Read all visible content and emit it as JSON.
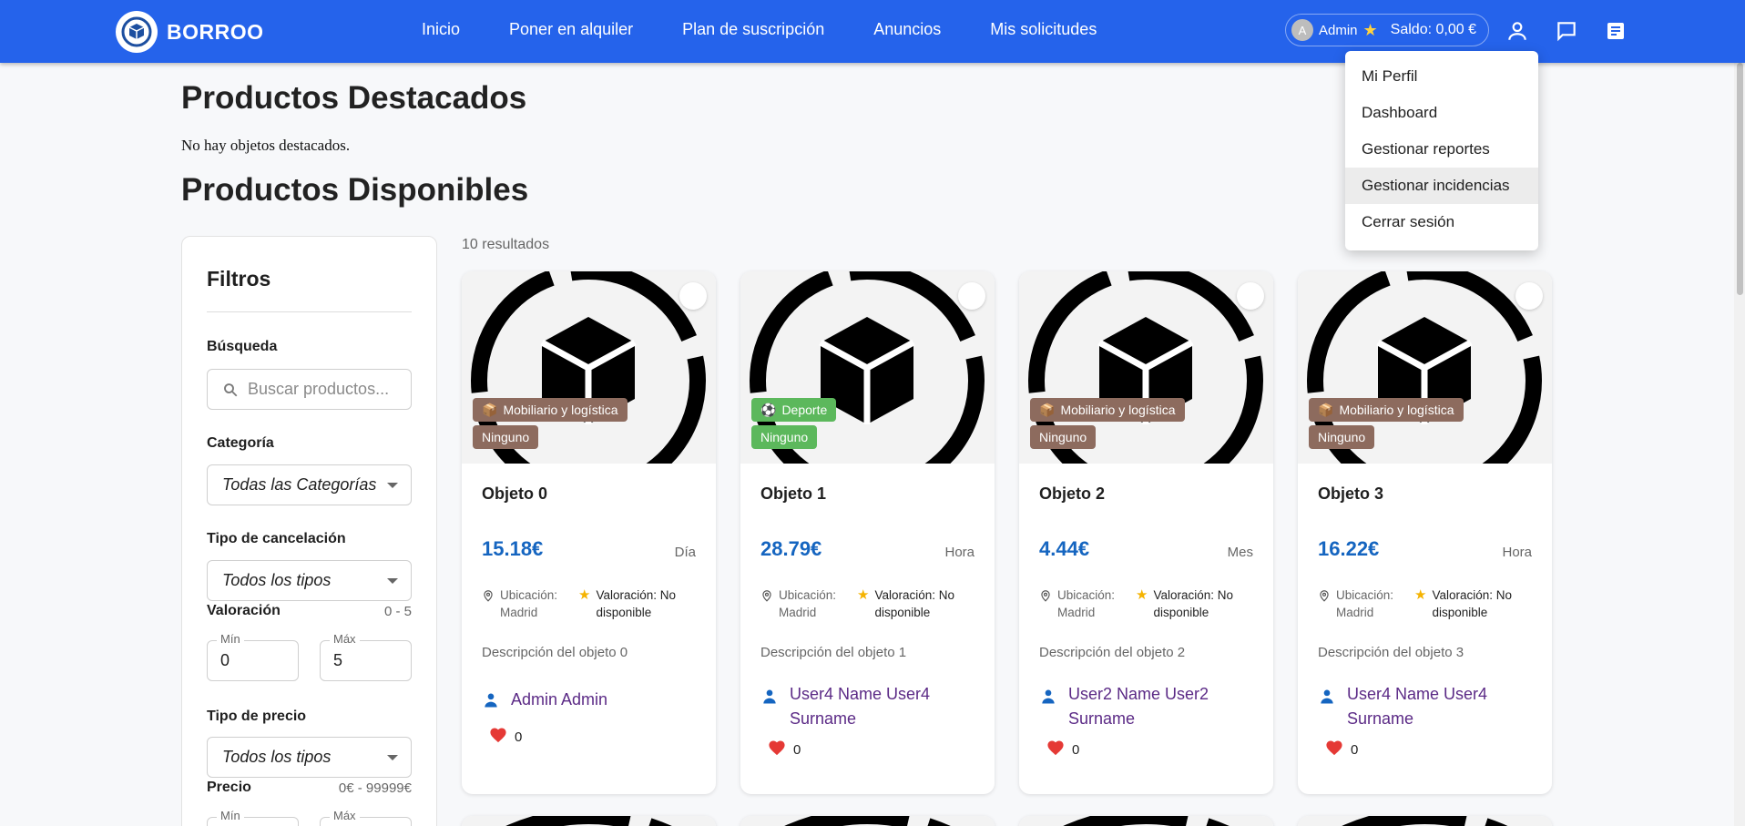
{
  "brand": {
    "name": "BORROO"
  },
  "nav": {
    "links": [
      "Inicio",
      "Poner en alquiler",
      "Plan de suscripción",
      "Anuncios",
      "Mis solicitudes"
    ],
    "user_initial": "A",
    "user_name": "Admin",
    "saldo": "Saldo: 0,00 €"
  },
  "dropdown": {
    "items": [
      "Mi Perfil",
      "Dashboard",
      "Gestionar reportes",
      "Gestionar incidencias",
      "Cerrar sesión"
    ],
    "highlighted_index": 3
  },
  "page": {
    "featured_title": "Productos Destacados",
    "featured_empty": "No hay objetos destacados.",
    "available_title": "Productos Disponibles",
    "results": "10 resultados"
  },
  "filters": {
    "title": "Filtros",
    "search_label": "Búsqueda",
    "search_placeholder": "Buscar productos...",
    "category_label": "Categoría",
    "category_value": "Todas las Categorías",
    "cancel_label": "Tipo de cancelación",
    "cancel_value": "Todos los tipos",
    "rating_label": "Valoración",
    "rating_range": "0 - 5",
    "min_label": "Mín",
    "max_label": "Máx",
    "rating_min": "0",
    "rating_max": "5",
    "price_type_label": "Tipo de precio",
    "price_type_value": "Todos los tipos",
    "price_label": "Precio",
    "price_range": "0€ - 99999€"
  },
  "cards": [
    {
      "title": "Objeto 0",
      "price": "15.18€",
      "unit": "Día",
      "category": "Mobiliario y logística",
      "category_icon": "box-emoji-icon",
      "tag": "Ninguno",
      "color": "#8d6b5e",
      "location_label": "Ubicación:",
      "location": "Madrid",
      "rating_label": "Valoración: No",
      "rating_value": "disponible",
      "description": "Descripción del objeto 0",
      "owner_line1": "Admin Admin",
      "owner_line2": "",
      "likes": "0"
    },
    {
      "title": "Objeto 1",
      "price": "28.79€",
      "unit": "Hora",
      "category": "Deporte",
      "category_icon": "soccer-ball-icon",
      "tag": "Ninguno",
      "color": "#5cb85c",
      "location_label": "Ubicación:",
      "location": "Madrid",
      "rating_label": "Valoración: No",
      "rating_value": "disponible",
      "description": "Descripción del objeto 1",
      "owner_line1": "User4 Name User4",
      "owner_line2": "Surname",
      "likes": "0"
    },
    {
      "title": "Objeto 2",
      "price": "4.44€",
      "unit": "Mes",
      "category": "Mobiliario y logística",
      "category_icon": "box-emoji-icon",
      "tag": "Ninguno",
      "color": "#8d6b5e",
      "location_label": "Ubicación:",
      "location": "Madrid",
      "rating_label": "Valoración: No",
      "rating_value": "disponible",
      "description": "Descripción del objeto 2",
      "owner_line1": "User2 Name User2",
      "owner_line2": "Surname",
      "likes": "0"
    },
    {
      "title": "Objeto 3",
      "price": "16.22€",
      "unit": "Hora",
      "category": "Mobiliario y logística",
      "category_icon": "box-emoji-icon",
      "tag": "Ninguno",
      "color": "#8d6b5e",
      "location_label": "Ubicación:",
      "location": "Madrid",
      "rating_label": "Valoración: No",
      "rating_value": "disponible",
      "description": "Descripción del objeto 3",
      "owner_line1": "User4 Name User4",
      "owner_line2": "Surname",
      "likes": "0"
    }
  ],
  "colors": {
    "primary": "#2563eb",
    "price": "#1565c0",
    "owner": "#5b2a86",
    "heart": "#e53935",
    "star": "#f5b301"
  }
}
